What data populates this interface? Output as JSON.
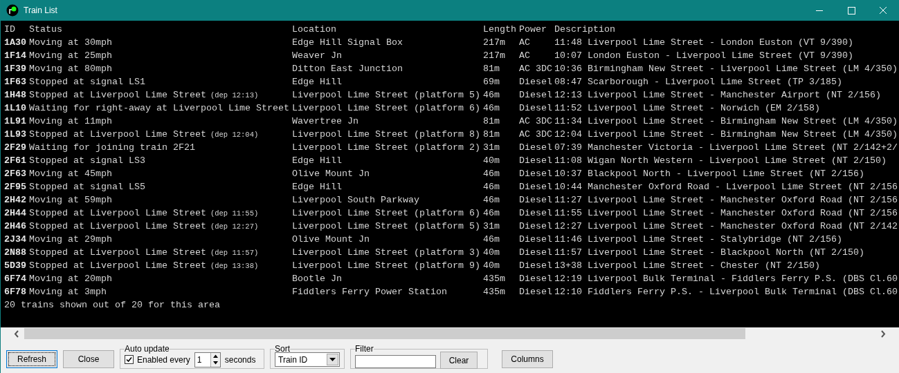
{
  "window": {
    "title": "Train List"
  },
  "table": {
    "columns": [
      "ID",
      "Status",
      "Location",
      "Length",
      "Power",
      "Description"
    ],
    "rows": [
      {
        "id": "1A30",
        "status": "Moving at 30mph",
        "location": "Edge Hill Signal Box",
        "length": "217m",
        "power": "AC",
        "description": "11:48 Liverpool Lime Street - London Euston (VT 9/390)"
      },
      {
        "id": "1F14",
        "status": "Moving at 25mph",
        "location": "Weaver Jn",
        "length": "217m",
        "power": "AC",
        "description": "10:07 London Euston - Liverpool Lime Street (VT 9/390)"
      },
      {
        "id": "1F39",
        "status": "Moving at 80mph",
        "location": "Ditton East Junction",
        "length": "81m",
        "power": "AC 3DC",
        "description": "10:36 Birmingham New Street - Liverpool Lime Street (LM 4/350)"
      },
      {
        "id": "1F63",
        "status": "Stopped at signal LS1",
        "location": "Edge Hill",
        "length": "69m",
        "power": "Diesel",
        "description": "08:47 Scarborough - Liverpool Lime Street (TP 3/185)"
      },
      {
        "id": "1H48",
        "status": "Stopped at Liverpool Lime Street",
        "departure": "(dep 12:13)",
        "location": "Liverpool Lime Street (platform 5)",
        "length": "46m",
        "power": "Diesel",
        "description": "12:13 Liverpool Lime Street - Manchester Airport (NT 2/156)"
      },
      {
        "id": "1L10",
        "status": "Waiting for right-away at Liverpool Lime Street",
        "location": "Liverpool Lime Street (platform 6)",
        "length": "46m",
        "power": "Diesel",
        "description": "11:52 Liverpool Lime Street - Norwich (EM 2/158)"
      },
      {
        "id": "1L91",
        "status": "Moving at 11mph",
        "location": "Wavertree Jn",
        "length": "81m",
        "power": "AC 3DC",
        "description": "11:34 Liverpool Lime Street - Birmingham New Street (LM 4/350)"
      },
      {
        "id": "1L93",
        "status": "Stopped at Liverpool Lime Street",
        "departure": "(dep 12:04)",
        "location": "Liverpool Lime Street (platform 8)",
        "length": "81m",
        "power": "AC 3DC",
        "description": "12:04 Liverpool Lime Street - Birmingham New Street (LM 4/350)"
      },
      {
        "id": "2F29",
        "status": "Waiting for joining train 2F21",
        "location": "Liverpool Lime Street (platform 2)",
        "length": "31m",
        "power": "Diesel",
        "description": "07:39 Manchester Victoria - Liverpool Lime Street (NT 2/142+2/"
      },
      {
        "id": "2F61",
        "status": "Stopped at signal LS3",
        "location": "Edge Hill",
        "length": "40m",
        "power": "Diesel",
        "description": "11:08 Wigan North Western - Liverpool Lime Street (NT 2/150)"
      },
      {
        "id": "2F63",
        "status": "Moving at 45mph",
        "location": "Olive Mount Jn",
        "length": "46m",
        "power": "Diesel",
        "description": "10:37 Blackpool North - Liverpool Lime Street (NT 2/156)"
      },
      {
        "id": "2F95",
        "status": "Stopped at signal LS5",
        "location": "Edge Hill",
        "length": "46m",
        "power": "Diesel",
        "description": "10:44 Manchester Oxford Road - Liverpool Lime Street (NT 2/156"
      },
      {
        "id": "2H42",
        "status": "Moving at 59mph",
        "location": "Liverpool South Parkway",
        "length": "46m",
        "power": "Diesel",
        "description": "11:27 Liverpool Lime Street - Manchester Oxford Road (NT 2/156"
      },
      {
        "id": "2H44",
        "status": "Stopped at Liverpool Lime Street",
        "departure": "(dep 11:55)",
        "location": "Liverpool Lime Street (platform 6)",
        "length": "46m",
        "power": "Diesel",
        "description": "11:55 Liverpool Lime Street - Manchester Oxford Road (NT 2/156"
      },
      {
        "id": "2H46",
        "status": "Stopped at Liverpool Lime Street",
        "departure": "(dep 12:27)",
        "location": "Liverpool Lime Street (platform 5)",
        "length": "31m",
        "power": "Diesel",
        "description": "12:27 Liverpool Lime Street - Manchester Oxford Road (NT 2/142"
      },
      {
        "id": "2J34",
        "status": "Moving at 29mph",
        "location": "Olive Mount Jn",
        "length": "46m",
        "power": "Diesel",
        "description": "11:46 Liverpool Lime Street - Stalybridge (NT 2/156)"
      },
      {
        "id": "2N88",
        "status": "Stopped at Liverpool Lime Street",
        "departure": "(dep 11:57)",
        "location": "Liverpool Lime Street (platform 3)",
        "length": "40m",
        "power": "Diesel",
        "description": "11:57 Liverpool Lime Street - Blackpool North (NT 2/150)"
      },
      {
        "id": "5D39",
        "status": "Stopped at Liverpool Lime Street",
        "departure": "(dep 13:38)",
        "location": "Liverpool Lime Street (platform 9)",
        "length": "40m",
        "power": "Diesel",
        "description": "13+38 Liverpool Lime Street - Chester (NT 2/150)"
      },
      {
        "id": "6F74",
        "status": "Moving at 20mph",
        "location": "Bootle Jn",
        "length": "435m",
        "power": "Diesel",
        "description": "12:19 Liverpool Bulk Terminal - Fiddlers Ferry P.S. (DBS Cl.60"
      },
      {
        "id": "6F78",
        "status": "Moving at 3mph",
        "location": "Fiddlers Ferry Power Station",
        "length": "435m",
        "power": "Diesel",
        "description": "12:10 Fiddlers Ferry P.S. - Liverpool Bulk Terminal (DBS Cl.60"
      }
    ],
    "summary": "20 trains shown out of 20 for this area"
  },
  "controls": {
    "refresh": "Refresh",
    "close": "Close",
    "auto_update": {
      "title": "Auto update",
      "enabled_label": "Enabled every",
      "checked": true,
      "interval": "1",
      "unit": "seconds"
    },
    "sort": {
      "title": "Sort",
      "value": "Train ID"
    },
    "filter": {
      "title": "Filter",
      "clear": "Clear"
    },
    "columns": "Columns"
  }
}
